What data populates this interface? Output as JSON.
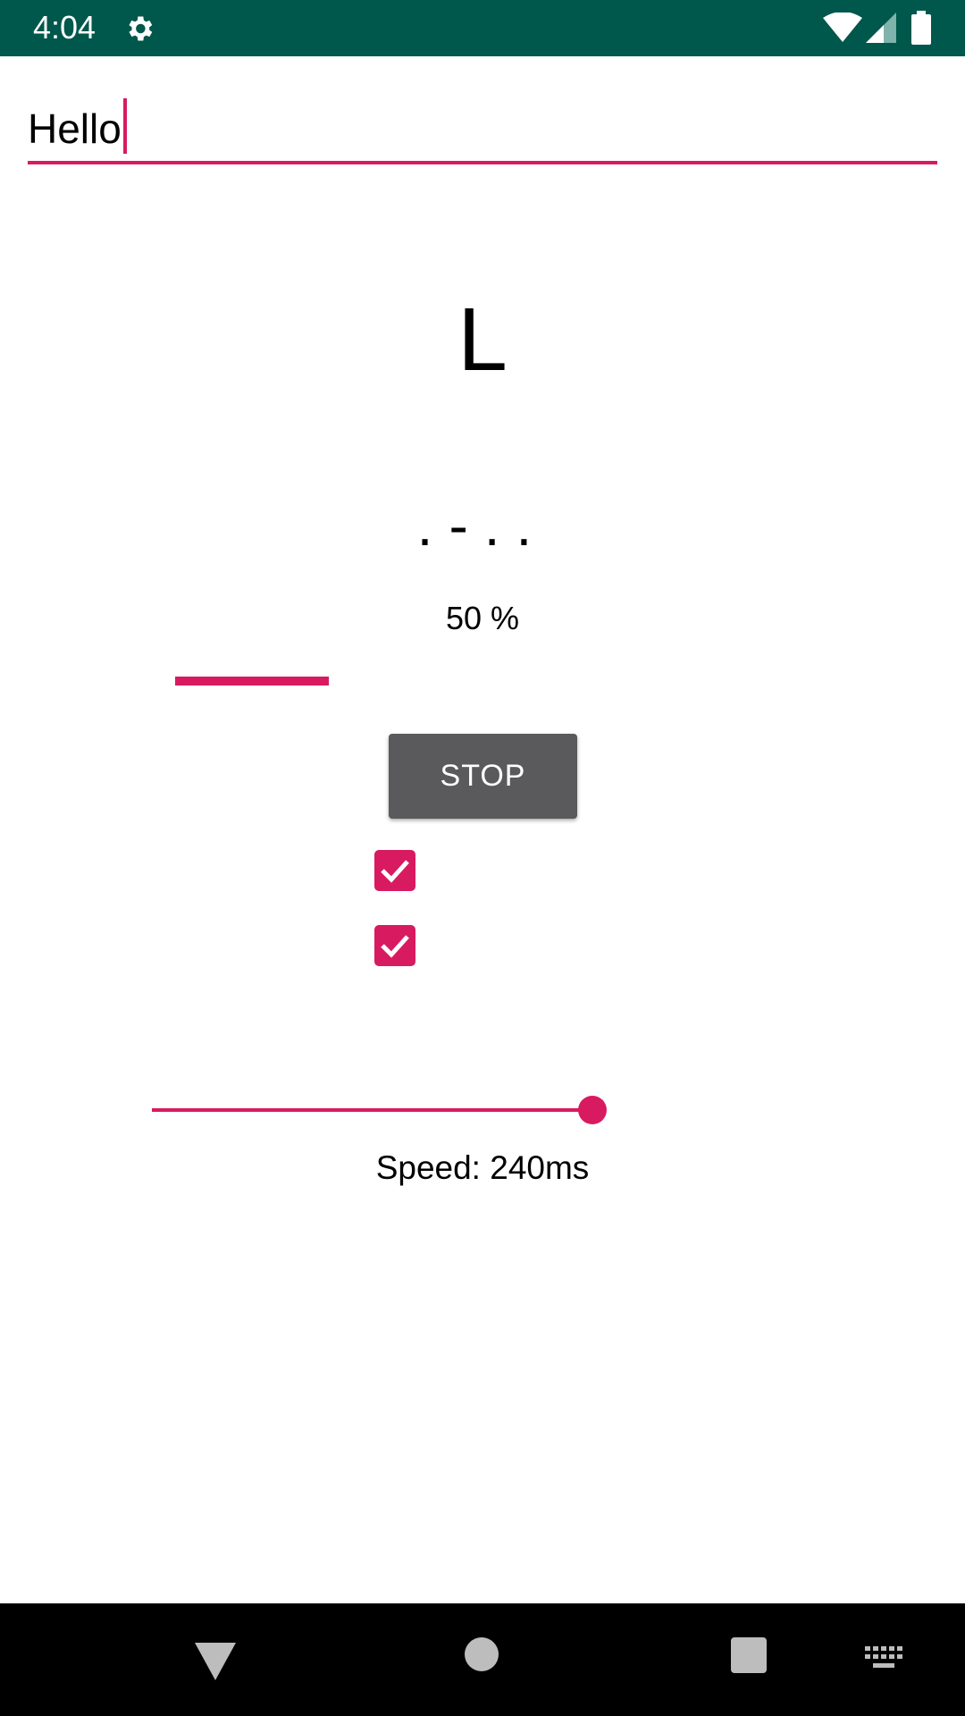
{
  "status_bar": {
    "time": "4:04",
    "icons": [
      "gear-icon",
      "wifi-icon",
      "signal-icon",
      "battery-icon"
    ]
  },
  "text_input": {
    "value": "Hello"
  },
  "current_letter": "L",
  "morse_code": ".-..",
  "progress": {
    "label": "50 %",
    "value_percent": 50
  },
  "stop_button": {
    "label": "STOP"
  },
  "checkboxes": [
    {
      "checked": true
    },
    {
      "checked": true
    }
  ],
  "speed_slider": {
    "value_fraction": 1.0
  },
  "speed_label": "Speed: 240ms",
  "nav_bar": {
    "icons": [
      "back-icon",
      "home-icon",
      "recents-icon",
      "keyboard-icon"
    ]
  },
  "colors": {
    "status_bar": "#00574b",
    "accent": "#d81b60",
    "button": "#5a5a5c"
  }
}
